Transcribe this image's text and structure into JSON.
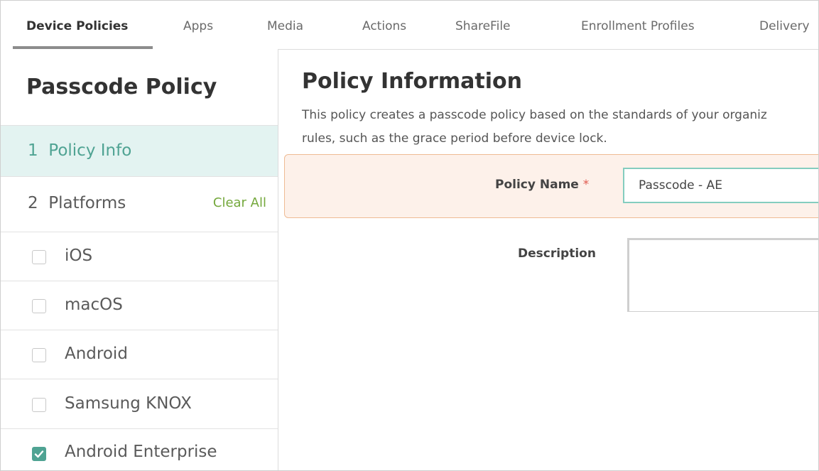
{
  "tabs": [
    {
      "label": "Device Policies",
      "active": true
    },
    {
      "label": "Apps"
    },
    {
      "label": "Media"
    },
    {
      "label": "Actions"
    },
    {
      "label": "ShareFile"
    },
    {
      "label": "Enrollment Profiles"
    },
    {
      "label": "Delivery"
    }
  ],
  "sidebar": {
    "title": "Passcode Policy",
    "steps": [
      {
        "number": "1",
        "label": "Policy Info",
        "active": true
      },
      {
        "number": "2",
        "label": "Platforms",
        "action": "Clear All"
      }
    ],
    "platforms": [
      {
        "label": "iOS",
        "checked": false
      },
      {
        "label": "macOS",
        "checked": false
      },
      {
        "label": "Android",
        "checked": false
      },
      {
        "label": "Samsung KNOX",
        "checked": false
      },
      {
        "label": "Android Enterprise",
        "checked": true
      }
    ]
  },
  "main": {
    "title": "Policy Information",
    "description": "This policy creates a passcode policy based on the standards of your organiz rules, such as the grace period before device lock.",
    "description_line1": "This policy creates a passcode policy based on the standards of your organiz",
    "description_line2": "rules, such as the grace period before device lock.",
    "policy_name_label": "Policy Name",
    "required_mark": "*",
    "policy_name_value": "Passcode  - AE",
    "description_label": "Description",
    "description_value": ""
  },
  "colors": {
    "accent": "#4fa393",
    "clear_all": "#74a83c",
    "required": "#e05a4f",
    "highlight_band": "#fdf1ea"
  }
}
